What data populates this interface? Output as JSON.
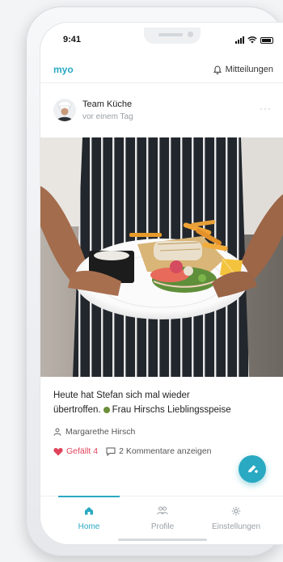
{
  "status_bar": {
    "time": "9:41"
  },
  "app_bar": {
    "brand": "myo",
    "notifications_label": "Mitteilungen"
  },
  "post": {
    "author": "Team Küche",
    "time_ago": "vor einem Tag",
    "more": "···",
    "caption_line1": "Heute hat Stefan sich mal wieder",
    "caption_line2_a": "übertroffen.",
    "caption_line2_b": "Frau Hirschs Lieblingsspeise",
    "tagged_person": "Margarethe Hirsch",
    "like_label": "Gefällt 4",
    "comments_label": "2 Kommentare anzeigen"
  },
  "tabs": [
    {
      "label": "Home",
      "icon": "home-icon",
      "active": true
    },
    {
      "label": "Profile",
      "icon": "people-icon",
      "active": false
    },
    {
      "label": "Einstellungen",
      "icon": "gear-icon",
      "active": false
    }
  ],
  "colors": {
    "accent": "#2aa9c2",
    "like": "#e0435b"
  }
}
